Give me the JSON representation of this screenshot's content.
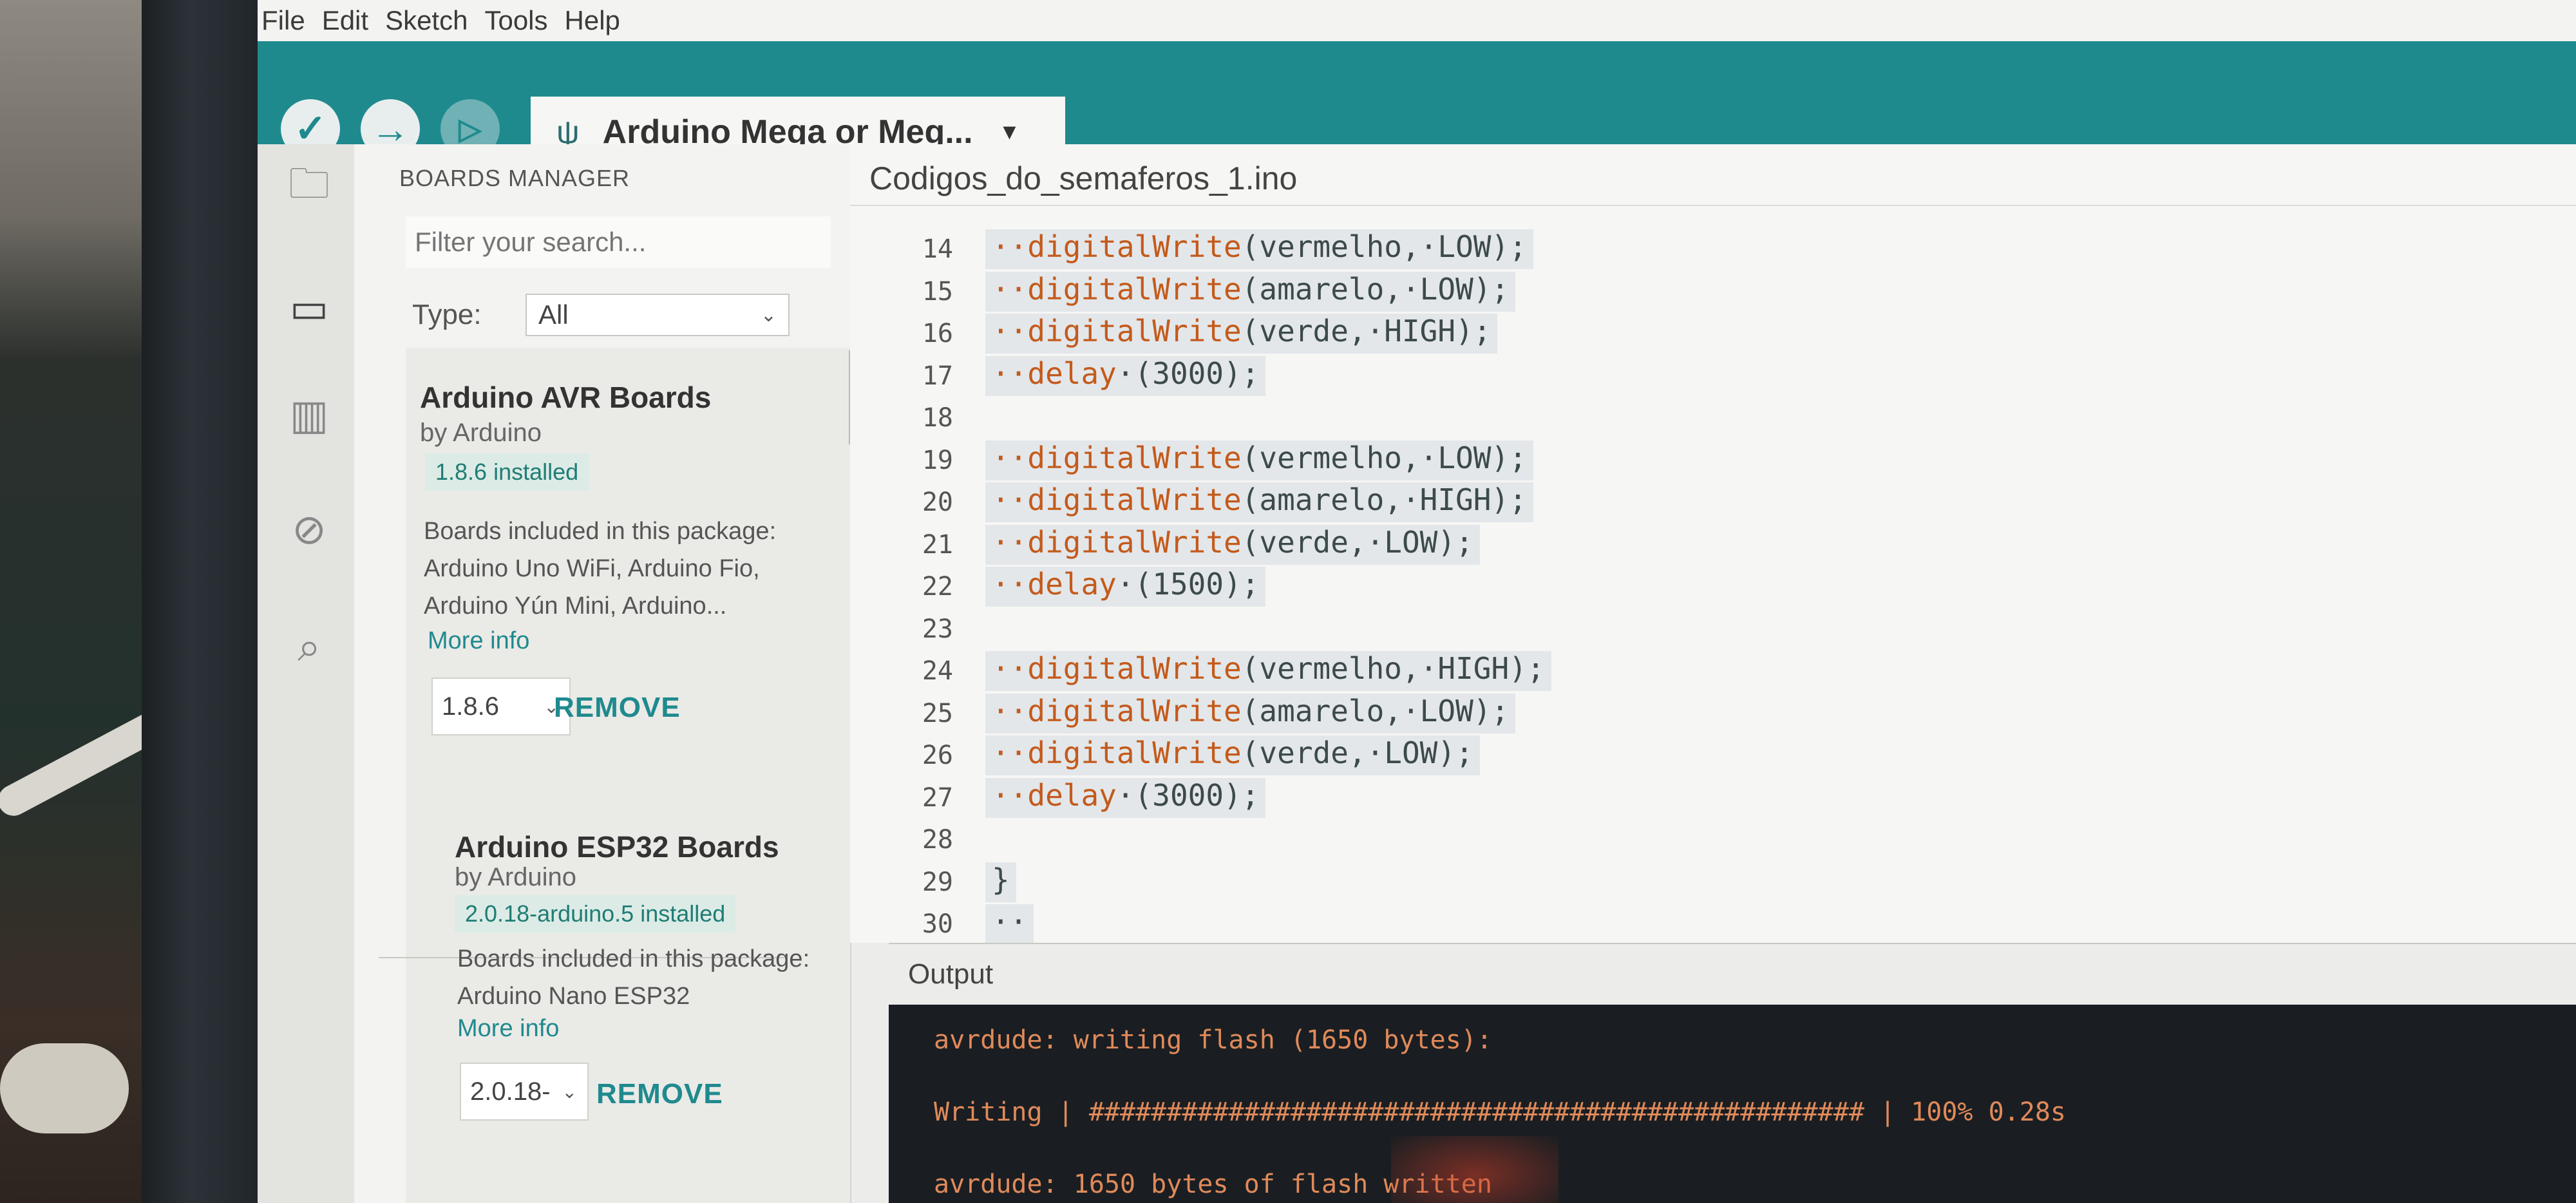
{
  "menu": [
    "File",
    "Edit",
    "Sketch",
    "Tools",
    "Help"
  ],
  "toolbar": {
    "verify_icon": "check-icon",
    "upload_icon": "arrow-right-icon",
    "debug_icon": "debug-icon",
    "usb_icon": "usb-icon",
    "board": "Arduino Mega or Meg...",
    "accent_color": "#1f8a8e"
  },
  "rail": {
    "items": [
      "folder-icon",
      "board-icon",
      "library-icon",
      "debug-off-icon",
      "search-icon"
    ],
    "glyphs": [
      "🗀",
      "▭",
      "▥",
      "⊘",
      "⌕"
    ]
  },
  "boards_manager": {
    "title": "BOARDS MANAGER",
    "search_placeholder": "Filter your search...",
    "type_label": "Type:",
    "type_value": "All",
    "packages": [
      {
        "name": "Arduino AVR Boards",
        "author": "by Arduino",
        "installed": "1.8.6 installed",
        "desc_heading": "Boards included in this package:",
        "desc_line1": "Arduino Uno WiFi, Arduino Fio,",
        "desc_line2": "Arduino Yún Mini, Arduino...",
        "more": "More info",
        "version": "1.8.6",
        "action": "REMOVE"
      },
      {
        "name": "Arduino ESP32 Boards",
        "author": "by Arduino",
        "installed": "2.0.18-arduino.5 installed",
        "desc_heading": "Boards included in this package:",
        "desc_line1": "Arduino Nano ESP32",
        "more": "More info",
        "version": "2.0.18-",
        "action": "REMOVE"
      }
    ]
  },
  "editor": {
    "filename": "Codigos_do_semaferos_1.ino",
    "lines": [
      {
        "no": "14",
        "fn": "··digitalWrite",
        "args": "(vermelho,·LOW);"
      },
      {
        "no": "15",
        "fn": "··digitalWrite",
        "args": "(amarelo,·LOW);"
      },
      {
        "no": "16",
        "fn": "··digitalWrite",
        "args": "(verde,·HIGH);"
      },
      {
        "no": "17",
        "fn": "··delay",
        "args": "·(3000);"
      },
      {
        "no": "18",
        "fn": "",
        "args": ""
      },
      {
        "no": "19",
        "fn": "··digitalWrite",
        "args": "(vermelho,·LOW);"
      },
      {
        "no": "20",
        "fn": "··digitalWrite",
        "args": "(amarelo,·HIGH);"
      },
      {
        "no": "21",
        "fn": "··digitalWrite",
        "args": "(verde,·LOW);"
      },
      {
        "no": "22",
        "fn": "··delay",
        "args": "·(1500);"
      },
      {
        "no": "23",
        "fn": "",
        "args": ""
      },
      {
        "no": "24",
        "fn": "··digitalWrite",
        "args": "(vermelho,·HIGH);"
      },
      {
        "no": "25",
        "fn": "··digitalWrite",
        "args": "(amarelo,·LOW);"
      },
      {
        "no": "26",
        "fn": "··digitalWrite",
        "args": "(verde,·LOW);"
      },
      {
        "no": "27",
        "fn": "··delay",
        "args": "·(3000);"
      },
      {
        "no": "28",
        "fn": "",
        "args": ""
      },
      {
        "no": "29",
        "fn": "",
        "args": "}"
      },
      {
        "no": "30",
        "fn": "",
        "args": "··"
      }
    ]
  },
  "output": {
    "title": "Output",
    "line1": "avrdude: writing flash (1650 bytes):",
    "line2": "Writing | ################################################## | 100% 0.28s",
    "line3": "avrdude: 1650 bytes of flash written"
  }
}
